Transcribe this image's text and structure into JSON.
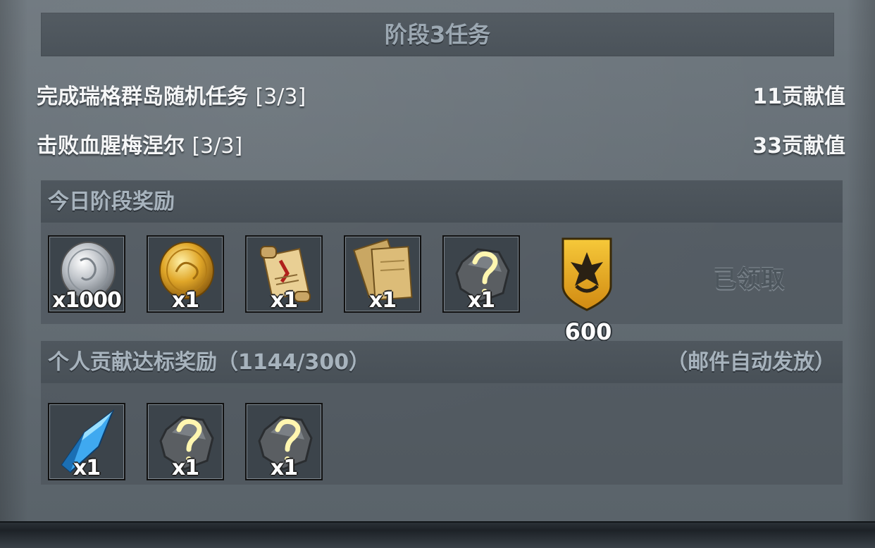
{
  "title": "阶段3任务",
  "tasks": [
    {
      "name": "完成瑞格群岛随机任务",
      "progress": "[3/3]",
      "reward": "11贡献值"
    },
    {
      "name": "击败血腥梅涅尔",
      "progress": "[3/3]",
      "reward": "33贡献值"
    }
  ],
  "daily_rewards": {
    "title": "今日阶段奖励",
    "items": [
      {
        "icon": "silver-coin-icon",
        "qty": "x1000"
      },
      {
        "icon": "gold-coin-icon",
        "qty": "x1"
      },
      {
        "icon": "scroll-icon",
        "qty": "x1"
      },
      {
        "icon": "parchment-icon",
        "qty": "x1"
      },
      {
        "icon": "mystery-stone-icon",
        "qty": "x1"
      }
    ],
    "shield": {
      "icon": "guild-shield-icon",
      "value": "600"
    },
    "status": "已领取"
  },
  "personal_rewards": {
    "title": "个人贡献达标奖励（1144/300）",
    "note": "（邮件自动发放）",
    "items": [
      {
        "icon": "blue-crystal-icon",
        "qty": "x1"
      },
      {
        "icon": "mystery-stone-icon",
        "qty": "x1"
      },
      {
        "icon": "mystery-stone-icon",
        "qty": "x1"
      }
    ]
  },
  "colors": {
    "panel": "#636c73",
    "header": "#4b535a",
    "header_text": "#a7b3bd",
    "gold": "#e2a92a",
    "crystal": "#3fa9f0"
  }
}
